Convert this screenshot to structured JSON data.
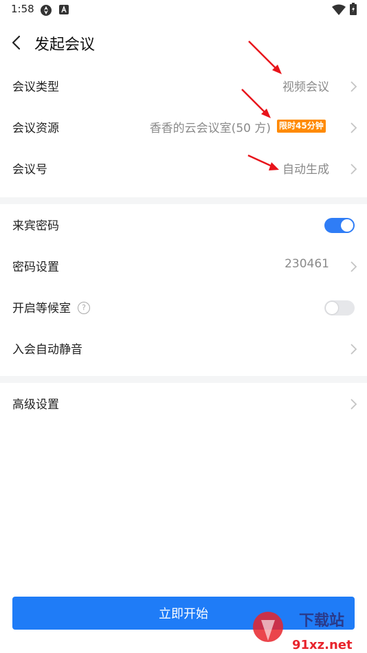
{
  "status_bar": {
    "time": "1:58"
  },
  "nav": {
    "title": "发起会议"
  },
  "rows": {
    "meeting_type": {
      "label": "会议类型",
      "value": "视频会议"
    },
    "meeting_resource": {
      "label": "会议资源",
      "value": "香香的云会议室(50 方)",
      "badge": "限时45分钟"
    },
    "meeting_number": {
      "label": "会议号",
      "value": "自动生成"
    },
    "guest_password": {
      "label": "来宾密码",
      "enabled": true
    },
    "password_settings": {
      "label": "密码设置",
      "value": "230461"
    },
    "waiting_room": {
      "label": "开启等候室",
      "help": "?",
      "enabled": false
    },
    "auto_mute": {
      "label": "入会自动静音"
    },
    "advanced": {
      "label": "高级设置"
    }
  },
  "start_button": {
    "label": "立即开始"
  },
  "watermark": {
    "brand": "下载站",
    "domain": "91xz.net"
  },
  "colors": {
    "accent": "#1f7cf7",
    "toggle_on": "#2f7df6",
    "badge": "#ff8a00",
    "annotation_arrow": "#e8141b"
  }
}
